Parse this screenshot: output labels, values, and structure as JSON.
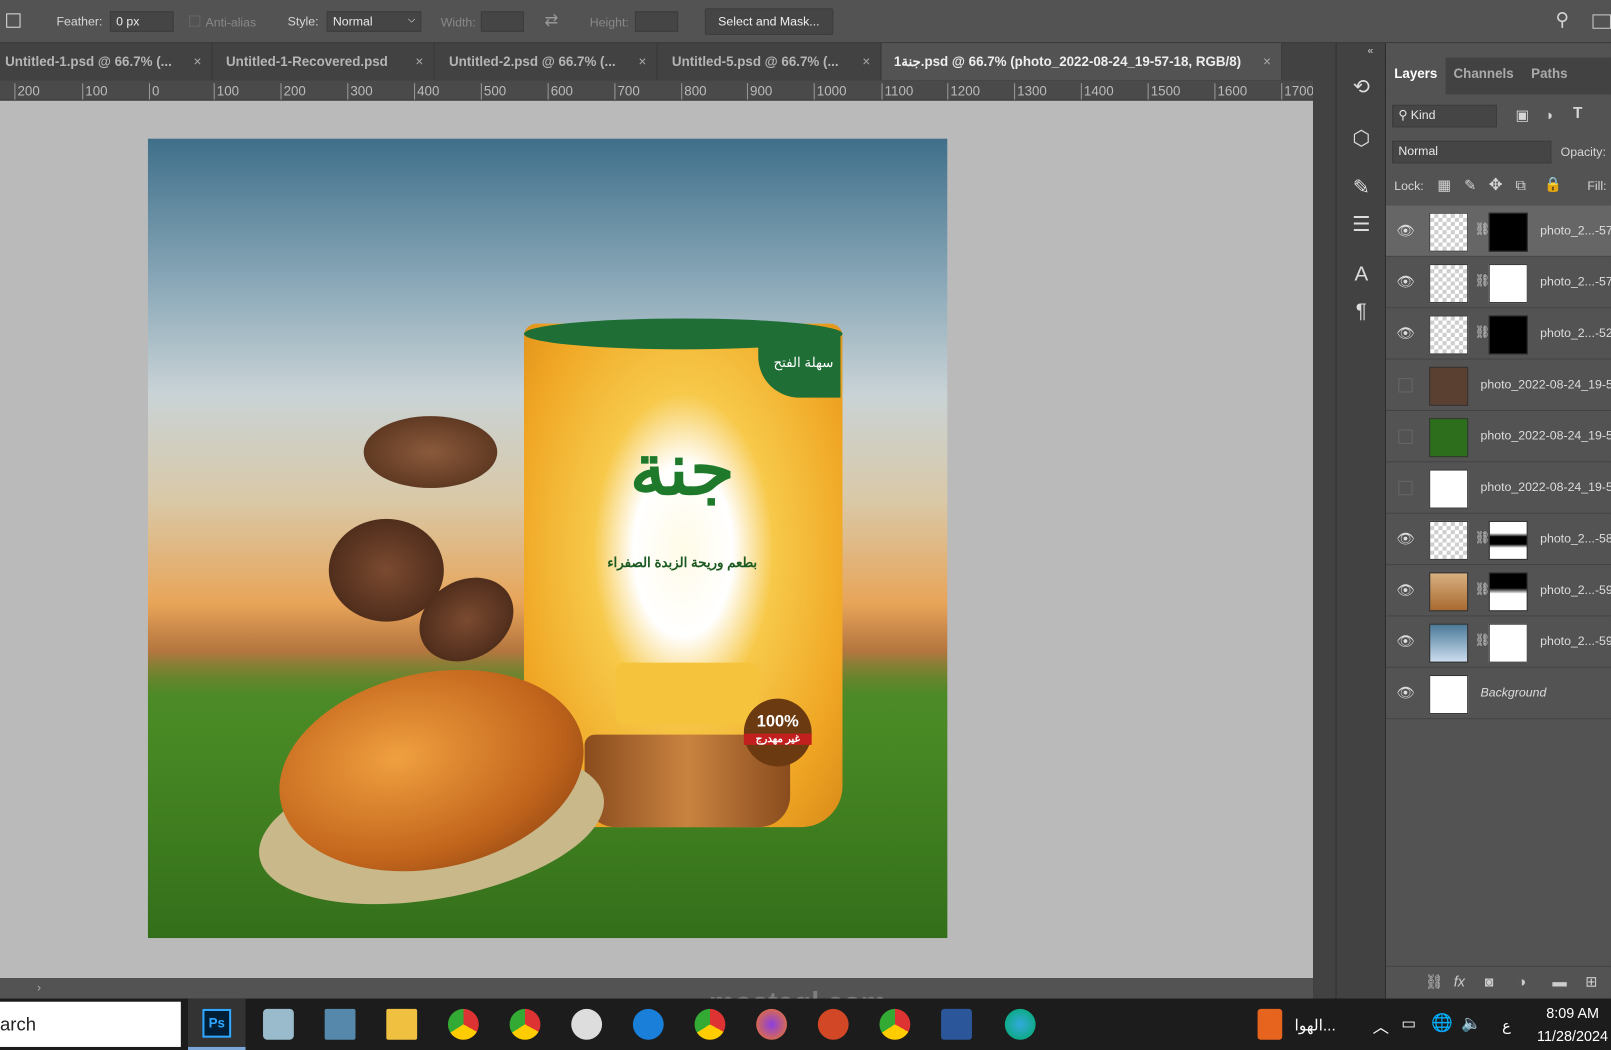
{
  "options_bar": {
    "feather_label": "Feather:",
    "feather_value": "0 px",
    "antialias_label": "Anti-alias",
    "style_label": "Style:",
    "style_value": "Normal",
    "width_label": "Width:",
    "height_label": "Height:",
    "select_mask": "Select and Mask..."
  },
  "tabs": [
    {
      "label": "Untitled-1.psd @ 66.7% (..."
    },
    {
      "label": "Untitled-1-Recovered.psd"
    },
    {
      "label": "Untitled-2.psd @ 66.7% (..."
    },
    {
      "label": "Untitled-5.psd @ 66.7% (..."
    },
    {
      "label": "جنة1.psd @ 66.7% (photo_2022-08-24_19-57-18, RGB/8)",
      "active": true
    }
  ],
  "ruler": [
    "200",
    "100",
    "0",
    "100",
    "200",
    "300",
    "400",
    "500",
    "600",
    "700",
    "800",
    "900",
    "1000",
    "1100",
    "1200",
    "1300",
    "1400",
    "1500",
    "1600",
    "1700"
  ],
  "poster": {
    "brand": "جنة",
    "tagline": "بطعم وريحة الزبدة الصفراء",
    "badge_easy": "سهلة الفتح",
    "badge_pct": "100%",
    "badge_sub": "غير مهدرج"
  },
  "panel": {
    "tabs": [
      "Layers",
      "Channels",
      "Paths"
    ],
    "kind": "Kind",
    "blend": "Normal",
    "opacity_label": "Opacity:",
    "lock_label": "Lock:",
    "fill_label": "Fill:"
  },
  "layers": [
    {
      "name": "photo_2...-57",
      "visible": true,
      "mask": true,
      "selected": true
    },
    {
      "name": "photo_2...-57",
      "visible": true,
      "mask": true
    },
    {
      "name": "photo_2...-52",
      "visible": true,
      "mask": true
    },
    {
      "name": "photo_2022-08-24_19-5",
      "visible": false,
      "mask": false
    },
    {
      "name": "photo_2022-08-24_19-5",
      "visible": false,
      "mask": false
    },
    {
      "name": "photo_2022-08-24_19-5",
      "visible": false,
      "mask": false
    },
    {
      "name": "photo_2...-58",
      "visible": true,
      "mask": true
    },
    {
      "name": "photo_2...-59",
      "visible": true,
      "mask": true
    },
    {
      "name": "photo_2...-59",
      "visible": true,
      "mask": true
    },
    {
      "name": "Background",
      "visible": true,
      "mask": false,
      "italic": true
    }
  ],
  "taskbar": {
    "search": "arch",
    "app_label": "الهوا...",
    "lang": "ع",
    "time": "8:09 AM",
    "date": "11/28/2024"
  },
  "watermark": "mostaql.com"
}
